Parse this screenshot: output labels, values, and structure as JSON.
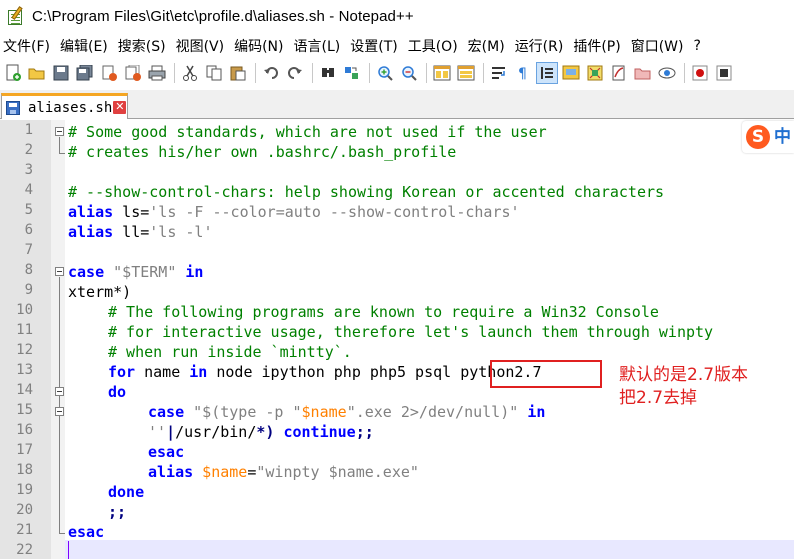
{
  "window": {
    "title": "C:\\Program Files\\Git\\etc\\profile.d\\aliases.sh - Notepad++"
  },
  "menu": [
    "文件(F)",
    "编辑(E)",
    "搜索(S)",
    "视图(V)",
    "编码(N)",
    "语言(L)",
    "设置(T)",
    "工具(O)",
    "宏(M)",
    "运行(R)",
    "插件(P)",
    "窗口(W)",
    "?"
  ],
  "toolbar": {
    "icons": [
      "new-file-icon",
      "open-file-icon",
      "save-icon",
      "save-all-icon",
      "close-icon",
      "close-all-icon",
      "print-icon",
      "cut-icon",
      "copy-icon",
      "paste-icon",
      "undo-icon",
      "redo-icon",
      "find-icon",
      "replace-icon",
      "zoom-in-icon",
      "zoom-out-icon",
      "sync-v-icon",
      "sync-h-icon",
      "word-wrap-icon",
      "show-all-chars-icon",
      "indent-guide-icon",
      "doc-map-icon",
      "function-list-icon",
      "folder-workspace-icon",
      "monitor-icon",
      "record-macro-icon",
      "stop-macro-icon"
    ]
  },
  "tab": {
    "label": "aliases.sh",
    "close": "✕"
  },
  "editor": {
    "line_numbers": [
      "1",
      "2",
      "3",
      "4",
      "5",
      "6",
      "7",
      "8",
      "9",
      "10",
      "11",
      "12",
      "13",
      "14",
      "15",
      "16",
      "17",
      "18",
      "19",
      "20",
      "21",
      "22"
    ]
  },
  "code": {
    "l1": "# Some good standards, which are not used if the user",
    "l2": "# creates his/her own .bashrc/.bash_profile",
    "l4": "# --show-control-chars: help showing Korean or accented characters",
    "l5_kw": "alias",
    "l5_a": " ls=",
    "l5_s": "'ls -F --color=auto --show-control-chars'",
    "l6_kw": "alias",
    "l6_a": " ll=",
    "l6_s": "'ls -l'",
    "l8_kw": "case",
    "l8_s": " \"$TERM\" ",
    "l8_kw2": "in",
    "l9": "xterm*)",
    "l10": "# The following programs are known to require a Win32 Console",
    "l11": "# for interactive usage, therefore let's launch them through winpty",
    "l12": "# when run inside `mintty`.",
    "l13_kw": "for",
    "l13_a": " name ",
    "l13_kw2": "in",
    "l13_b": " node ipython php php5 psql python2.7",
    "l14_kw": "do",
    "l15_kw": "case",
    "l15_s1": " \"$(type -p \"",
    "l15_v": "$name",
    "l15_s2": "\".exe 2>/dev/null)\" ",
    "l15_kw2": "in",
    "l16_s": "''",
    "l16_p": "|",
    "l16_a": "/usr/bin/",
    "l16_p2": "*)",
    "l16_kw": " continue",
    "l16_p3": ";;",
    "l17_kw": "esac",
    "l18_kw": "alias",
    "l18_v": " $name",
    "l18_a": "=",
    "l18_s": "\"winpty $name.exe\"",
    "l19_kw": "done",
    "l20_p": ";;",
    "l21_kw": "esac"
  },
  "annotation": {
    "line1": "默认的是2.7版本",
    "line2": "把2.7去掉"
  },
  "ime": {
    "logo": "S",
    "mode": "中"
  }
}
